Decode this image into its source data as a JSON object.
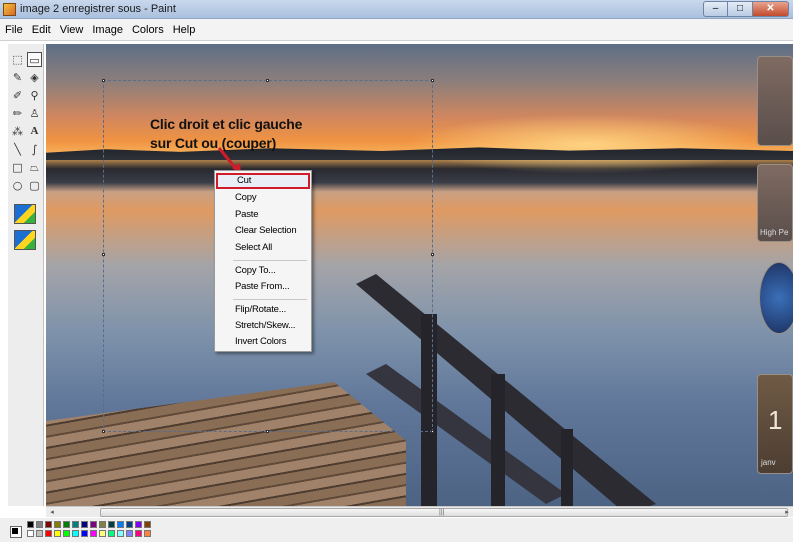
{
  "window": {
    "title": "image 2 enregistrer sous - Paint",
    "minimize": "–",
    "maximize": "□",
    "close": "✕"
  },
  "menubar": {
    "items": [
      "File",
      "Edit",
      "View",
      "Image",
      "Colors",
      "Help"
    ]
  },
  "toolbox": {
    "tools": [
      {
        "name": "free-select-icon",
        "glyph": "⬚"
      },
      {
        "name": "rect-select-icon",
        "glyph": "▭"
      },
      {
        "name": "eraser-icon",
        "glyph": "✎"
      },
      {
        "name": "fill-icon",
        "glyph": "◈"
      },
      {
        "name": "color-picker-icon",
        "glyph": "✐"
      },
      {
        "name": "magnifier-icon",
        "glyph": "⚲"
      },
      {
        "name": "pencil-icon",
        "glyph": "✏"
      },
      {
        "name": "brush-icon",
        "glyph": "♙"
      },
      {
        "name": "airbrush-icon",
        "glyph": "⁂"
      },
      {
        "name": "text-icon",
        "glyph": "A"
      },
      {
        "name": "line-icon",
        "glyph": "╲"
      },
      {
        "name": "curve-icon",
        "glyph": "∫"
      },
      {
        "name": "rectangle-icon",
        "glyph": "□"
      },
      {
        "name": "polygon-icon",
        "glyph": "⏢"
      },
      {
        "name": "ellipse-icon",
        "glyph": "○"
      },
      {
        "name": "rounded-rect-icon",
        "glyph": "▢"
      }
    ]
  },
  "annotation": {
    "line1": "Clic droit et clic gauche",
    "line2": "sur Cut ou (couper)"
  },
  "context_menu": {
    "groups": [
      [
        "Cut",
        "Copy",
        "Paste",
        "Clear Selection",
        "Select All"
      ],
      [
        "Copy To...",
        "Paste From..."
      ],
      [
        "Flip/Rotate...",
        "Stretch/Skew...",
        "Invert Colors"
      ]
    ],
    "highlighted": "Cut"
  },
  "gadgets": {
    "weather_label": "High Pe",
    "calendar_digit": "1",
    "calendar_label": "janv"
  },
  "scrollbar": {
    "left": "◂",
    "grip": "|||",
    "right": "▸"
  },
  "palette": {
    "top_row": [
      "#000000",
      "#808080",
      "#800000",
      "#808000",
      "#008000",
      "#008080",
      "#000080",
      "#800080",
      "#808040",
      "#004040",
      "#0080ff",
      "#004080",
      "#8000ff",
      "#804000"
    ],
    "bottom_row": [
      "#ffffff",
      "#c0c0c0",
      "#ff0000",
      "#ffff00",
      "#00ff00",
      "#00ffff",
      "#0000ff",
      "#ff00ff",
      "#ffff80",
      "#00ff80",
      "#80ffff",
      "#8080ff",
      "#ff0080",
      "#ff8040"
    ]
  },
  "colors": {
    "highlight_border": "#d11b2a",
    "selection_dash": "#5a6d8a"
  }
}
